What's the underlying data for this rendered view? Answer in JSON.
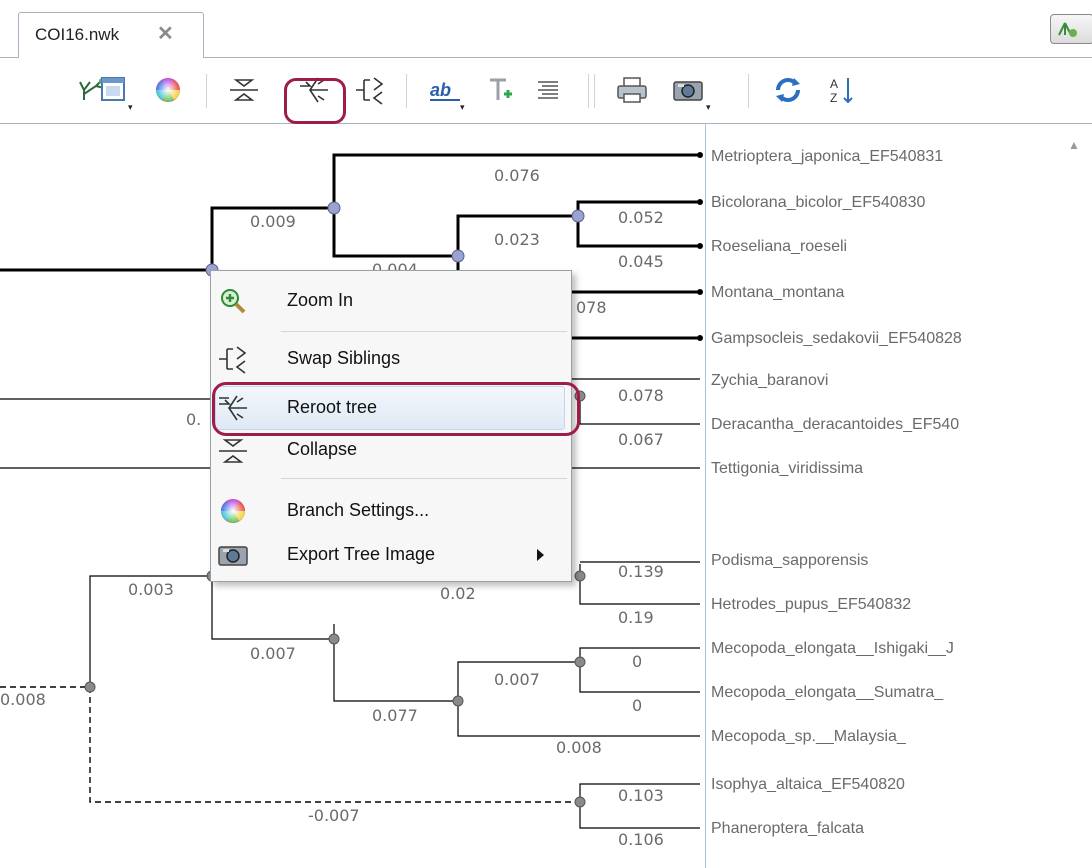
{
  "tab": {
    "title": "COI16.nwk",
    "close_icon": "close-icon"
  },
  "toolbar": {
    "items": [
      {
        "name": "tree-layout-icon"
      },
      {
        "name": "window-dropdown-icon"
      },
      {
        "name": "color-wheel-icon"
      },
      {
        "name": "collapse-icon"
      },
      {
        "name": "reroot-icon",
        "highlighted": true
      },
      {
        "name": "swap-siblings-icon"
      },
      {
        "name": "ab-labels-icon",
        "text": "ab"
      },
      {
        "name": "add-text-icon"
      },
      {
        "name": "align-icon"
      },
      {
        "name": "print-icon"
      },
      {
        "name": "camera-icon"
      },
      {
        "name": "refresh-icon"
      },
      {
        "name": "sort-az-icon",
        "text": "AZ"
      }
    ],
    "highlight_color": "#9e1c4c"
  },
  "tree": {
    "leaves": [
      "Metrioptera_japonica_EF540831",
      "Bicolorana_bicolor_EF540830",
      "Roeseliana_roeseli",
      "Montana_montana",
      "Gampsocleis_sedakovii_EF540828",
      "Zychia_baranovi",
      "Deracantha_deracantoides_EF540",
      "Tettigonia_viridissima",
      "Podisma_sapporensis",
      "Hetrodes_pupus_EF540832",
      "Mecopoda_elongata__Ishigaki__J",
      "Mecopoda_elongata__Sumatra_",
      "Mecopoda_sp.__Malaysia_",
      "Isophya_altaica_EF540820",
      "Phaneroptera_falcata"
    ],
    "branch_lengths": {
      "b076": "0.076",
      "b009": "0.009",
      "b052": "0.052",
      "b023": "0.023",
      "b045": "0.045",
      "b004": "0.004",
      "b078a": "078",
      "b0partial": "0.",
      "b078": "0.078",
      "b067": "0.067",
      "b003": "0.003",
      "b02": "0.02",
      "b139": "0.139",
      "b19": "0.19",
      "b007": "0.007",
      "b0a": "0",
      "b007b": "0.007",
      "b0b": "0",
      "b008left": "0.008",
      "b077": "0.077",
      "b008": "0.008",
      "b103": "0.103",
      "bneg007": "-0.007",
      "b106": "0.106"
    },
    "node_color": "#9aa3cf",
    "line_color": "#000000"
  },
  "context_menu": {
    "items": [
      {
        "label": "Zoom In",
        "icon": "zoom-in-icon"
      },
      {
        "label": "Swap Siblings",
        "icon": "swap-siblings-icon"
      },
      {
        "label": "Reroot tree",
        "icon": "reroot-icon",
        "hover": true
      },
      {
        "label": "Collapse",
        "icon": "collapse-icon"
      },
      {
        "label": "Branch Settings...",
        "icon": "color-wheel-icon"
      },
      {
        "label": "Export Tree Image",
        "icon": "camera-icon",
        "submenu": true
      }
    ]
  }
}
